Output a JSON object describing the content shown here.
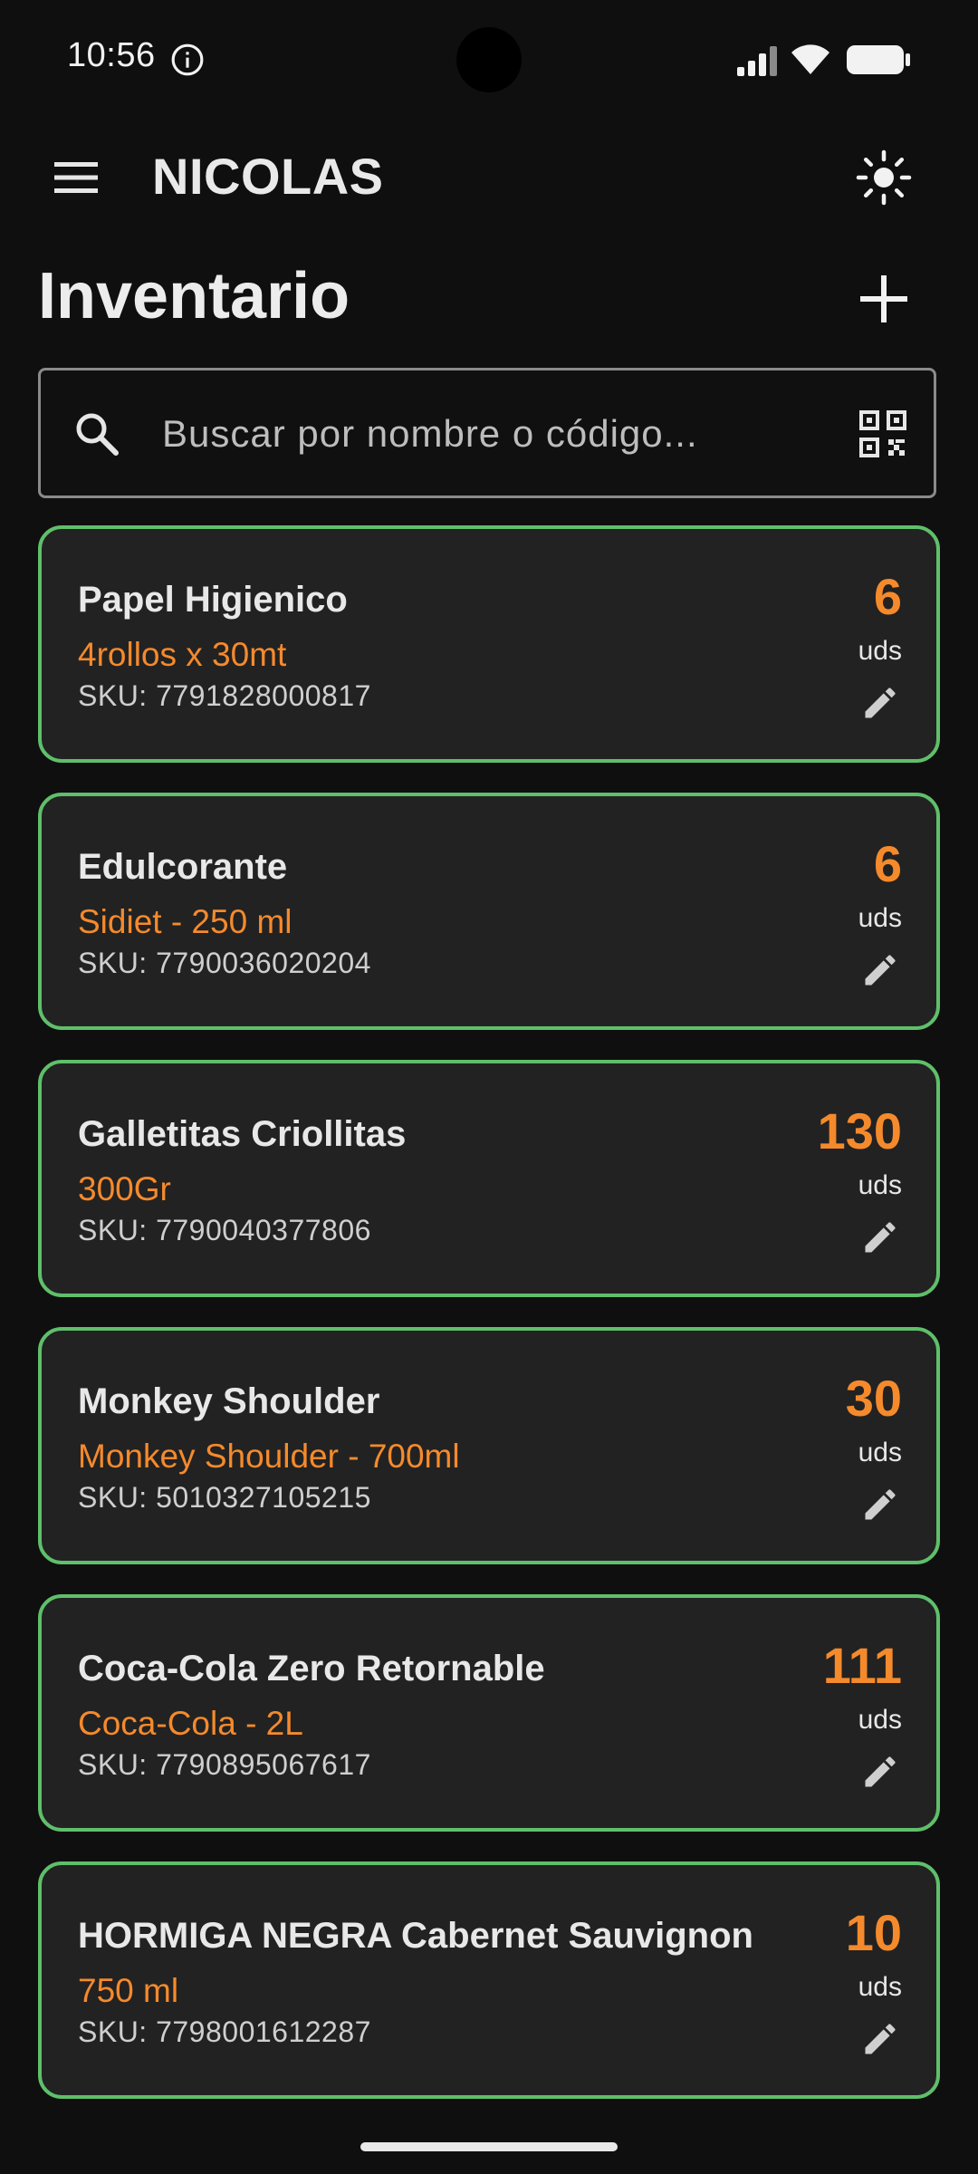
{
  "status_bar": {
    "time": "10:56",
    "icons": [
      "info-icon",
      "signal-icon",
      "wifi-icon",
      "battery-icon"
    ]
  },
  "app_bar": {
    "title": "NICOLAS",
    "icons": [
      "menu-icon",
      "theme-toggle-icon"
    ]
  },
  "page": {
    "title": "Inventario"
  },
  "search": {
    "placeholder": "Buscar por nombre o código...",
    "value": ""
  },
  "colors": {
    "background": "#0f0f0f",
    "card_background": "#222222",
    "card_border": "#5fbf6a",
    "accent": "#f58a2c"
  },
  "products": [
    {
      "name": "Papel Higienico",
      "description": "4rollos x 30mt",
      "sku": "SKU: 7791828000817",
      "qty": "6",
      "unit": "uds"
    },
    {
      "name": "Edulcorante",
      "description": "Sidiet - 250 ml",
      "sku": "SKU: 7790036020204",
      "qty": "6",
      "unit": "uds"
    },
    {
      "name": "Galletitas Criollitas",
      "description": "300Gr",
      "sku": "SKU: 7790040377806",
      "qty": "130",
      "unit": "uds"
    },
    {
      "name": "Monkey Shoulder",
      "description": "Monkey Shoulder - 700ml",
      "sku": "SKU: 5010327105215",
      "qty": "30",
      "unit": "uds"
    },
    {
      "name": "Coca-Cola Zero Retornable",
      "description": "Coca-Cola - 2L",
      "sku": "SKU: 7790895067617",
      "qty": "111",
      "unit": "uds"
    },
    {
      "name": "HORMIGA NEGRA Cabernet Sauvignon",
      "description": "750 ml",
      "sku": "SKU: 7798001612287",
      "qty": "10",
      "unit": "uds"
    }
  ]
}
